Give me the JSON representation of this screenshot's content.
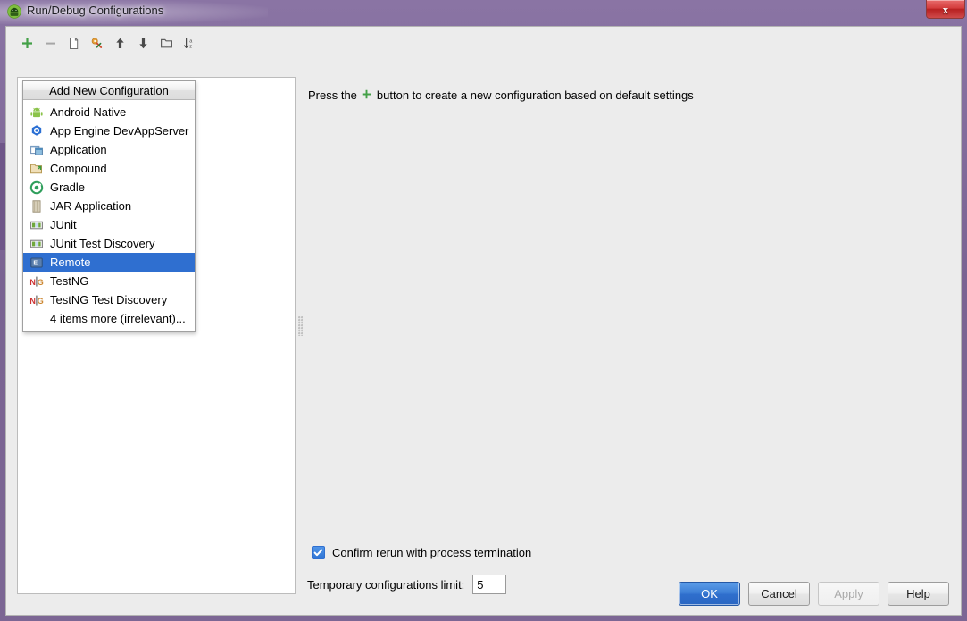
{
  "window": {
    "title": "Run/Debug Configurations",
    "app_icon": "android-studio-icon",
    "close_label": "x",
    "titlebar_color": "#7a6392",
    "accent_color": "#2f6fd0"
  },
  "toolbar": {
    "buttons": [
      {
        "name": "add-configuration-button",
        "icon": "plus-icon",
        "label": "+"
      },
      {
        "name": "remove-configuration-button",
        "icon": "minus-icon",
        "label": "-"
      },
      {
        "name": "copy-configuration-button",
        "icon": "copy-icon",
        "label": "Copy"
      },
      {
        "name": "save-configuration-button",
        "icon": "save-configuration-icon",
        "label": "Save"
      },
      {
        "name": "move-up-button",
        "icon": "arrow-up-icon",
        "label": "Up"
      },
      {
        "name": "move-down-button",
        "icon": "arrow-down-icon",
        "label": "Down"
      },
      {
        "name": "create-folder-button",
        "icon": "folder-icon",
        "label": "Folder"
      },
      {
        "name": "sort-configurations-button",
        "icon": "sort-az-icon",
        "label": "Sort"
      }
    ]
  },
  "popup": {
    "header": "Add New Configuration",
    "items": [
      {
        "label": "Android Native",
        "icon": "android-icon",
        "selected": false
      },
      {
        "label": "App Engine DevAppServer",
        "icon": "app-engine-icon",
        "selected": false
      },
      {
        "label": "Application",
        "icon": "application-icon",
        "selected": false
      },
      {
        "label": "Compound",
        "icon": "compound-folder-icon",
        "selected": false
      },
      {
        "label": "Gradle",
        "icon": "gradle-icon",
        "selected": false
      },
      {
        "label": "JAR Application",
        "icon": "jar-icon",
        "selected": false
      },
      {
        "label": "JUnit",
        "icon": "junit-icon",
        "selected": false
      },
      {
        "label": "JUnit Test Discovery",
        "icon": "junit-icon",
        "selected": false
      },
      {
        "label": "Remote",
        "icon": "remote-icon",
        "selected": true
      },
      {
        "label": "TestNG",
        "icon": "testng-icon",
        "selected": false
      },
      {
        "label": "TestNG Test Discovery",
        "icon": "testng-icon",
        "selected": false
      }
    ],
    "more_item": "4 items more (irrelevant)..."
  },
  "right_pane": {
    "hint_prefix": "Press the",
    "hint_icon": "plus-icon",
    "hint_suffix": "button to create a new configuration based on default settings"
  },
  "options": {
    "confirm_rerun_label": "Confirm rerun with process termination",
    "confirm_rerun_checked": true,
    "temp_limit_label": "Temporary configurations limit:",
    "temp_limit_value": "5"
  },
  "buttons": {
    "ok": "OK",
    "cancel": "Cancel",
    "apply": "Apply",
    "help": "Help"
  }
}
